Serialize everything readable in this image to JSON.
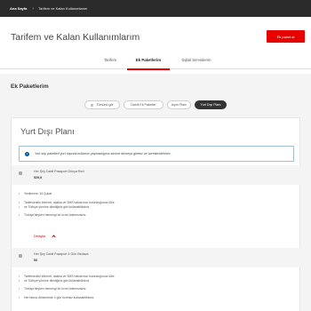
{
  "topbar": {
    "home_label": "Ana Sayfa",
    "separator": "›",
    "crumb": "Tarifem ve Kalan Kullanımlarım"
  },
  "header": {
    "title": "Tarifem ve Kalan Kullanımlarım",
    "cta_label": "Ek paket al"
  },
  "tabs": [
    {
      "label": "Tarifem",
      "active": false
    },
    {
      "label": "Ek Paketlerim",
      "active": true
    },
    {
      "label": "Dijital Servislerim",
      "active": false
    }
  ],
  "section": {
    "title": "Ek Paketlerim"
  },
  "filters": [
    {
      "label": "Tümünü gör",
      "active": false
    },
    {
      "label": "Dahili Ek Paketler",
      "active": false
    },
    {
      "label": "Aşım Planı",
      "active": false
    },
    {
      "label": "Yurt Dışı Planı",
      "active": true
    }
  ],
  "card": {
    "title": "Yurt Dışı Planı",
    "alert_text": "Yurt dışı paketleri yurt dışında kullanım yapmadığınız sürece devreye girmez ve ücretlendirilmez.",
    "packages": [
      {
        "name": "Her Şey Dahil Pasaport Dünya Red",
        "price": "529,9",
        "bullets": [
          "Yenilenme: 16 Şubat",
          "Tarifenizdeki internet, dakika ve SMS haklarınızı bulunduğunuz ülke",
          "ve Türkiye yönüne dilediğiniz gibi kullanabilirsiniz",
          "Türkiye'deyken hemengi bir ücret ödemezsiniz"
        ],
        "details_label": "Detaylar"
      },
      {
        "name": "Her Şey Dahil Pasaport 4 Gün Bedava",
        "price": "50",
        "bullets": [
          "Tarifenizdeki internet, dakika ve SMS haklarınızı bulunduğunuz ülke",
          "ve Türkiye yönüne dilediğiniz gibi kullanabilirsiniz",
          "Türkiye'deyken hemengi bir ücret ödemezsiniz",
          "Her fatura döneminde 4 gün ücretsiz kullanabilirsiniz"
        ]
      }
    ]
  },
  "colors": {
    "accent": "#e60000",
    "topbar": "#2b2b2b",
    "info": "#005ea5"
  }
}
